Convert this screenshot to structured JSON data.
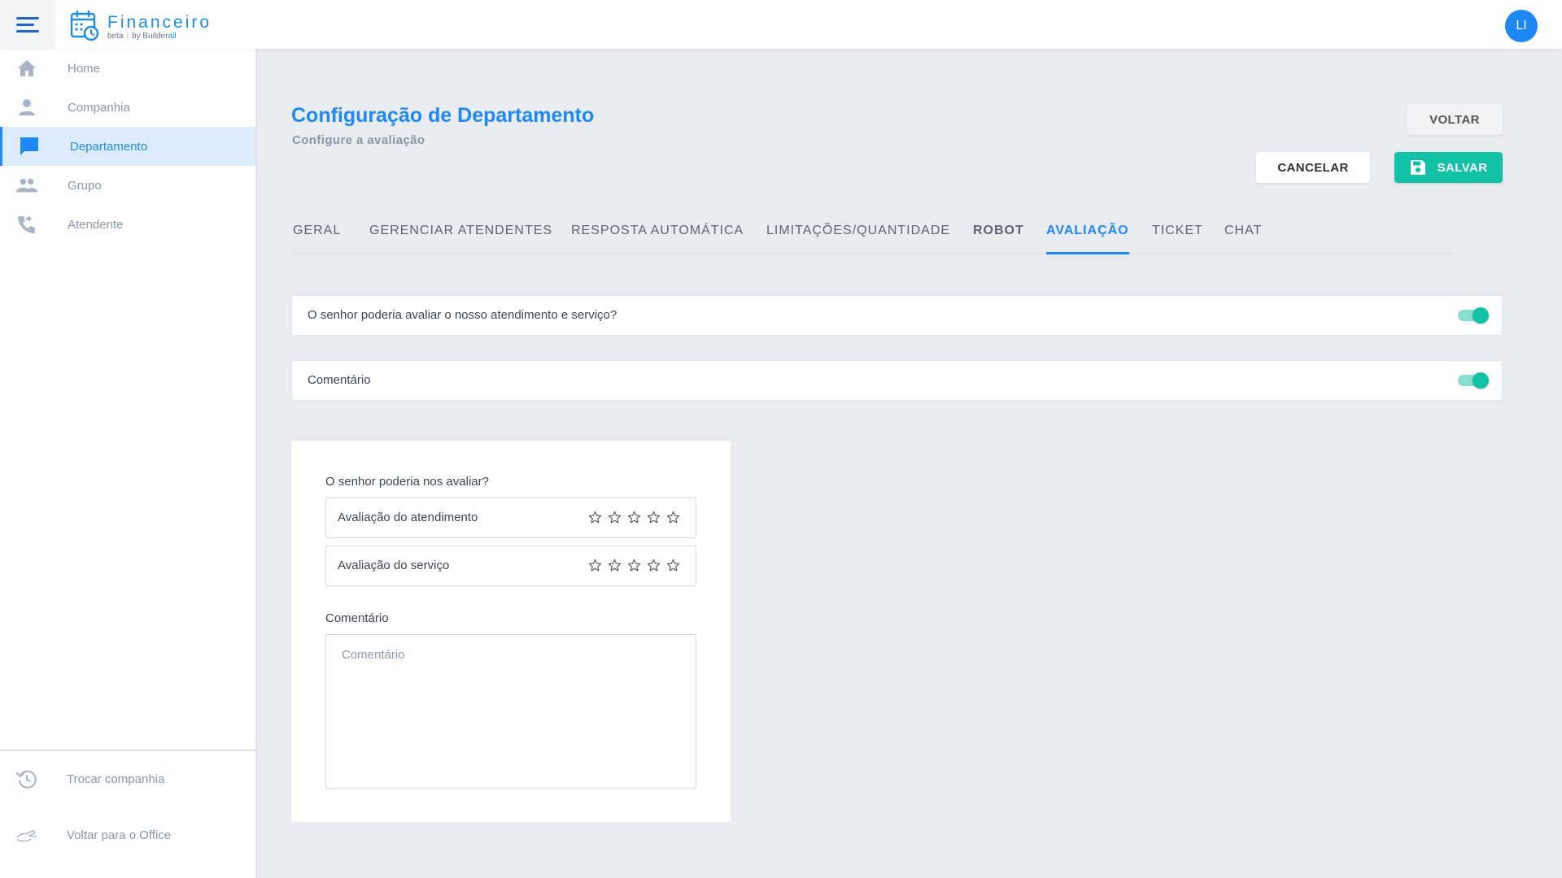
{
  "app": {
    "title": "Financeiro",
    "beta": "beta",
    "by": "by",
    "brand_a": "Builder",
    "brand_b": "all",
    "brand_color": "#1d8fe0"
  },
  "user": {
    "initials": "LI"
  },
  "sidebar": {
    "items": [
      {
        "label": "Home",
        "icon": "home-icon"
      },
      {
        "label": "Companhia",
        "icon": "person-icon"
      },
      {
        "label": "Departamento",
        "icon": "chat-icon",
        "active": true
      },
      {
        "label": "Grupo",
        "icon": "group-icon"
      },
      {
        "label": "Atendente",
        "icon": "phone-forward-icon"
      }
    ],
    "bottom": [
      {
        "label": "Trocar companhia",
        "icon": "history-icon"
      },
      {
        "label": "Voltar para o Office",
        "icon": "hand-icon"
      }
    ]
  },
  "page": {
    "title": "Configuração de Departamento",
    "subtitle": "Configure a avaliação"
  },
  "buttons": {
    "voltar": "VOLTAR",
    "cancelar": "CANCELAR",
    "salvar": "SALVAR"
  },
  "tabs": [
    {
      "label": "GERAL"
    },
    {
      "label": "GERENCIAR ATENDENTES"
    },
    {
      "label": "RESPOSTA AUTOMÁTICA"
    },
    {
      "label": "LIMITAÇÕES/QUANTIDADE"
    },
    {
      "label": "ROBOT"
    },
    {
      "label": "AVALIAÇÃO",
      "active": true
    },
    {
      "label": "TICKET"
    },
    {
      "label": "CHAT"
    }
  ],
  "settings": [
    {
      "label": "O senhor poderia avaliar o nosso atendimento e serviço?",
      "enabled": true
    },
    {
      "label": "Comentário",
      "enabled": true
    }
  ],
  "preview": {
    "question": "O senhor poderia nos avaliar?",
    "ratings": [
      {
        "label": "Avaliação do atendimento",
        "stars": 0,
        "max": 5
      },
      {
        "label": "Avaliação do serviço",
        "stars": 0,
        "max": 5
      }
    ],
    "comment_label": "Comentário",
    "comment_placeholder": "Comentário",
    "comment_value": ""
  },
  "colors": {
    "accent": "#1e88f5",
    "success": "#12c2a6",
    "background": "#e9ecf1"
  }
}
